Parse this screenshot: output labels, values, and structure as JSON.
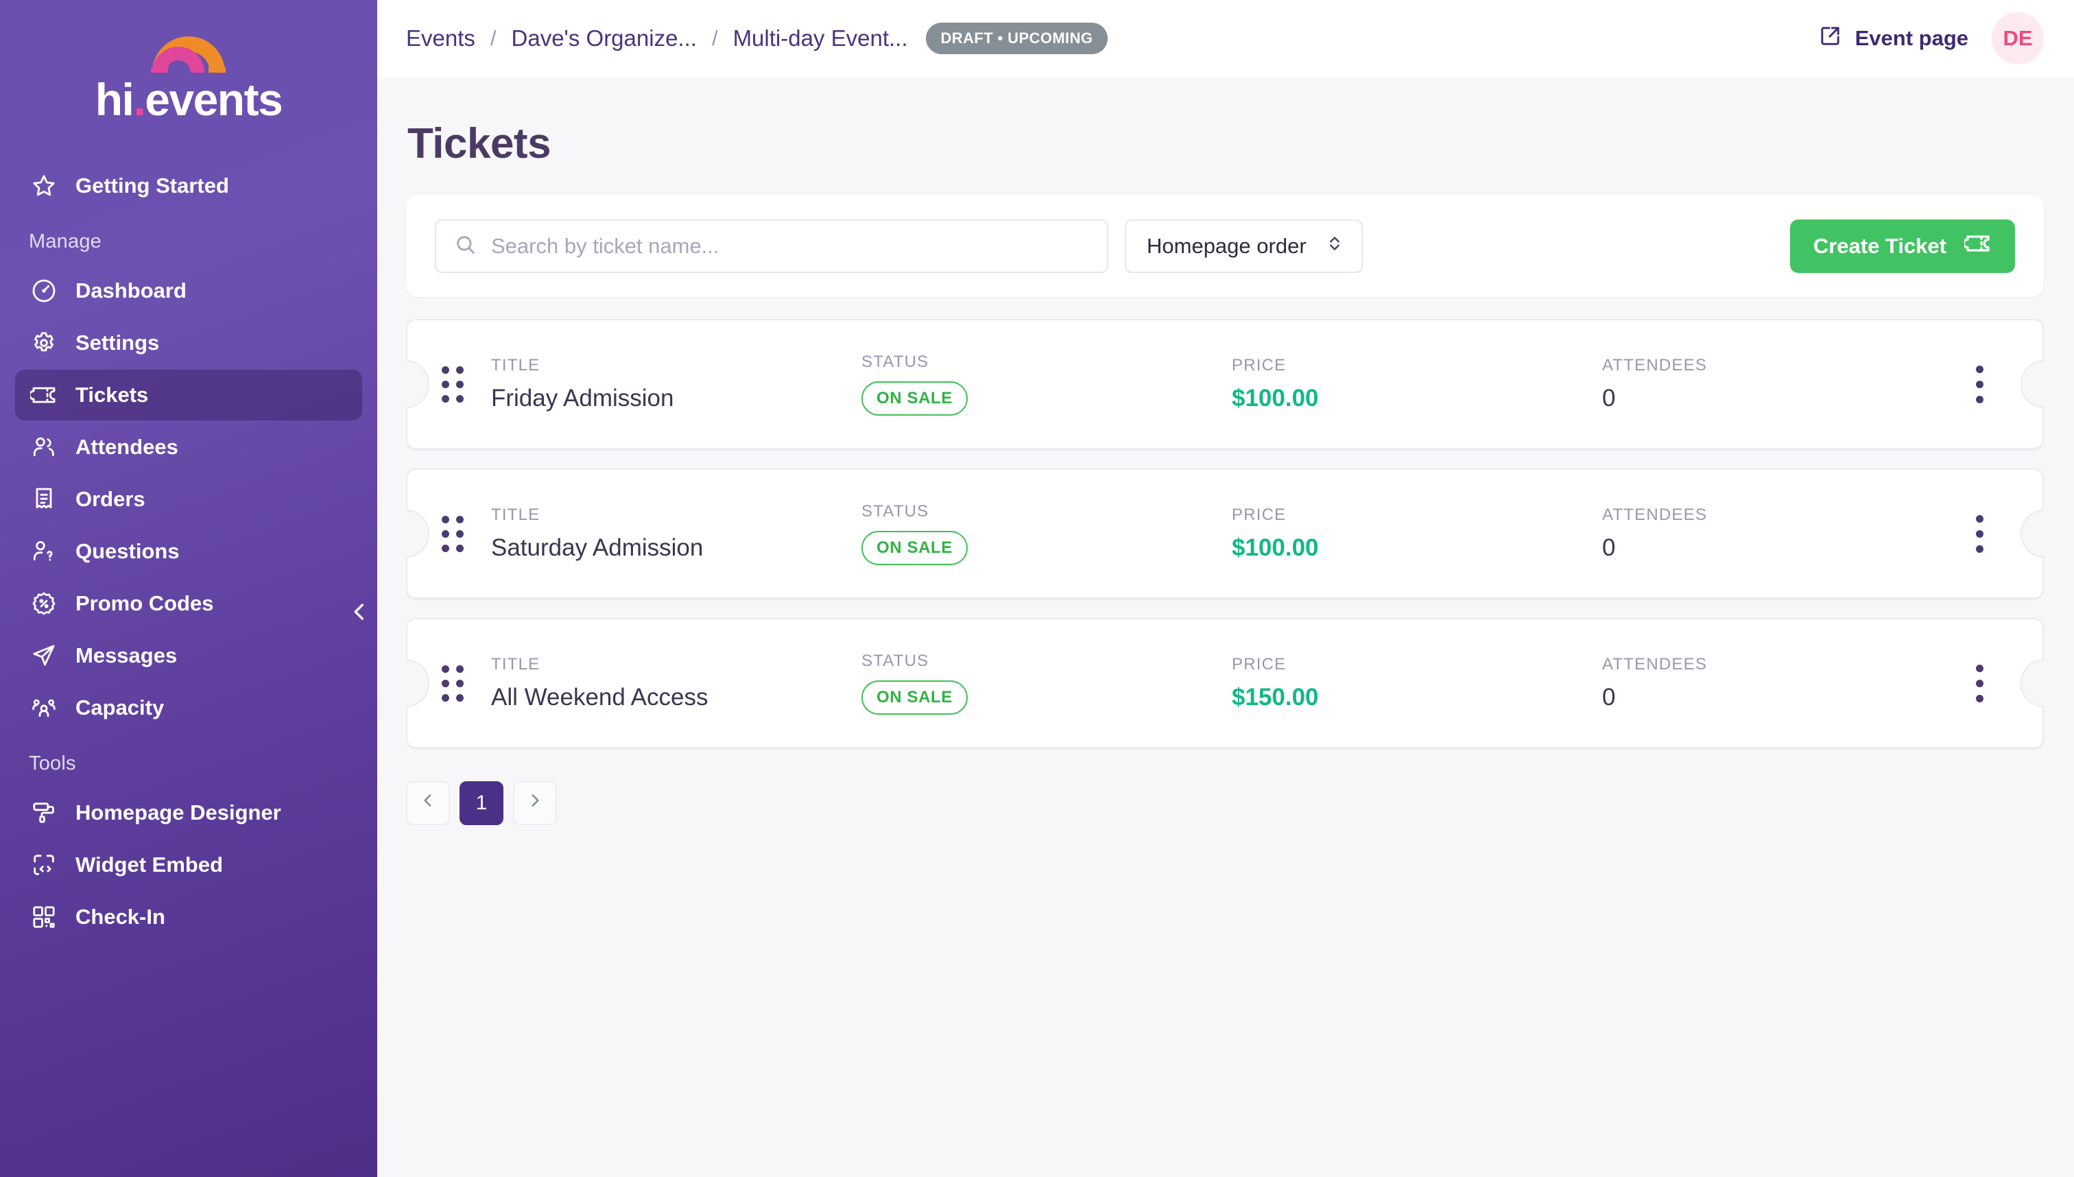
{
  "brand": {
    "name_prefix": "hi",
    "name_dot": ".",
    "name_suffix": "events",
    "accent_pink": "#ec4899",
    "accent_orange": "#f08c28",
    "sidebar_purple": "#5f3f9e"
  },
  "sidebar": {
    "top_item": {
      "label": "Getting Started",
      "icon": "star-icon"
    },
    "sections": [
      {
        "title": "Manage",
        "items": [
          {
            "label": "Dashboard",
            "icon": "gauge-icon",
            "active": false
          },
          {
            "label": "Settings",
            "icon": "gear-icon",
            "active": false
          },
          {
            "label": "Tickets",
            "icon": "ticket-icon",
            "active": true
          },
          {
            "label": "Attendees",
            "icon": "users-icon",
            "active": false
          },
          {
            "label": "Orders",
            "icon": "receipt-icon",
            "active": false
          },
          {
            "label": "Questions",
            "icon": "user-question-icon",
            "active": false
          },
          {
            "label": "Promo Codes",
            "icon": "discount-icon",
            "active": false
          },
          {
            "label": "Messages",
            "icon": "send-icon",
            "active": false
          },
          {
            "label": "Capacity",
            "icon": "group-icon",
            "active": false
          }
        ]
      },
      {
        "title": "Tools",
        "items": [
          {
            "label": "Homepage Designer",
            "icon": "paint-roller-icon",
            "active": false
          },
          {
            "label": "Widget Embed",
            "icon": "code-embed-icon",
            "active": false
          },
          {
            "label": "Check-In",
            "icon": "qr-code-icon",
            "active": false
          }
        ]
      }
    ],
    "collapse_icon": "chevron-left-icon"
  },
  "topbar": {
    "breadcrumbs": [
      {
        "label": "Events"
      },
      {
        "label": "Dave's Organize..."
      },
      {
        "label": "Multi-day Event..."
      }
    ],
    "separator": "/",
    "status_badge": "DRAFT • UPCOMING",
    "event_page_label": "Event page",
    "event_page_icon": "external-link-icon",
    "avatar_initials": "DE"
  },
  "page": {
    "title": "Tickets"
  },
  "toolbar": {
    "search_placeholder": "Search by ticket name...",
    "search_value": "",
    "search_icon": "search-icon",
    "sort_label": "Homepage order",
    "sort_icon": "chevron-up-down-icon",
    "create_label": "Create Ticket",
    "create_icon": "ticket-icon",
    "create_color": "#41c363"
  },
  "table": {
    "headers": {
      "title": "TITLE",
      "status": "STATUS",
      "price": "PRICE",
      "attendees": "ATTENDEES"
    },
    "rows": [
      {
        "title": "Friday Admission",
        "status": "ON SALE",
        "price": "$100.00",
        "attendees": "0"
      },
      {
        "title": "Saturday Admission",
        "status": "ON SALE",
        "price": "$100.00",
        "attendees": "0"
      },
      {
        "title": "All Weekend Access",
        "status": "ON SALE",
        "price": "$150.00",
        "attendees": "0"
      }
    ]
  },
  "pagination": {
    "prev_icon": "chevron-left-icon",
    "next_icon": "chevron-right-icon",
    "pages": [
      "1"
    ],
    "current": "1"
  }
}
